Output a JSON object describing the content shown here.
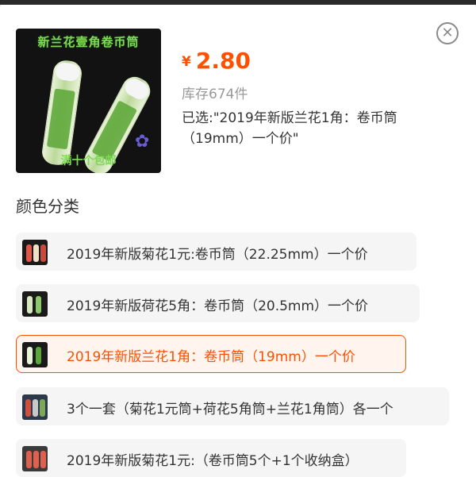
{
  "product": {
    "image_banner": "新兰花壹角卷币筒",
    "image_bottom_text": "满十个包邮",
    "currency": "¥",
    "price": "2.80",
    "stock": "库存674件",
    "selected": "已选:\"2019年新版兰花1角：卷币筒（19mm）一个价\""
  },
  "close_icon": "close-circle-icon",
  "section_title": "颜色分类",
  "options": [
    {
      "label": "2019年新版菊花1元:卷币筒（22.25mm）一个价",
      "active": false
    },
    {
      "label": "2019年新版荷花5角：卷币筒（20.5mm）一个价",
      "active": false
    },
    {
      "label": "2019年新版兰花1角：卷币筒（19mm）一个价",
      "active": true
    },
    {
      "label": "3个一套（菊花1元筒+荷花5角筒+兰花1角筒）各一个",
      "active": false
    },
    {
      "label": "2019年新版菊花1元:（卷币筒5个+1个收纳盒）",
      "active": false
    }
  ],
  "colors": {
    "accent": "#ff5000",
    "option_bg": "#f5f5f5",
    "active_bg": "#fff4ee"
  }
}
